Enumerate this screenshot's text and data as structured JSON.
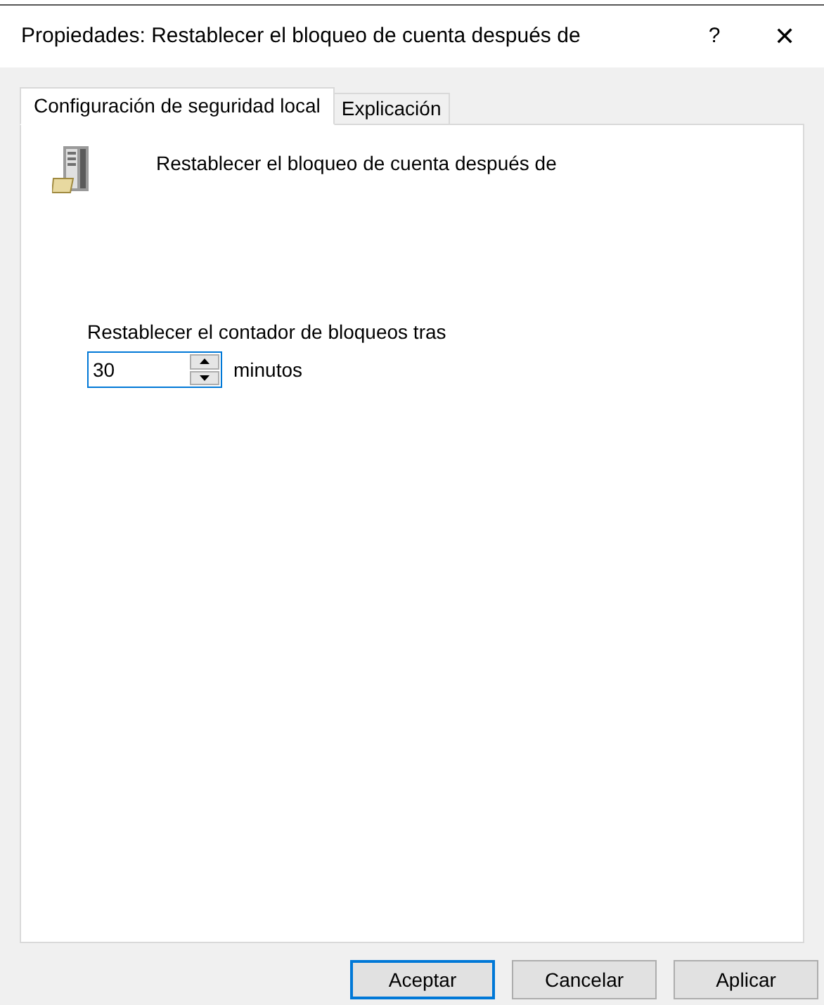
{
  "window": {
    "title": "Propiedades: Restablecer el bloqueo de cuenta después de",
    "help": "?",
    "close": "✕"
  },
  "tabs": [
    {
      "label": "Configuración de seguridad local",
      "selected": true
    },
    {
      "label": "Explicación",
      "selected": false
    }
  ],
  "policy": {
    "name": "Restablecer el bloqueo de cuenta después de"
  },
  "setting": {
    "label": "Restablecer el contador de bloqueos tras",
    "value": "30",
    "focused": true,
    "unit": "minutos"
  },
  "buttons": [
    {
      "label": "Aceptar",
      "default": true
    },
    {
      "label": "Cancelar",
      "default": false
    },
    {
      "label": "Aplicar",
      "default": false
    }
  ]
}
